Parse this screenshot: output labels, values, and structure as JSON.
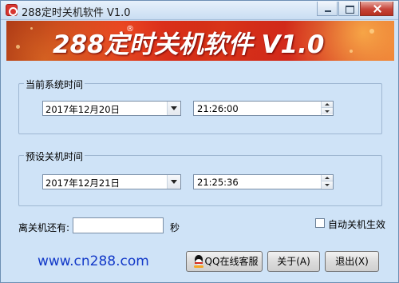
{
  "window": {
    "title": "288定时关机软件 V1.0"
  },
  "banner": {
    "text": "288定时关机软件 V1.0",
    "brand": "288",
    "registered_mark": "®"
  },
  "current_time_group": {
    "legend": "当前系统时间",
    "date_value": "2017年12月20日",
    "time_value": "21:26:00"
  },
  "shutdown_time_group": {
    "legend": "预设关机时间",
    "date_value": "2017年12月21日",
    "time_value": "21:25:36"
  },
  "countdown": {
    "label": "离关机还有:",
    "value": "",
    "unit": "秒"
  },
  "auto_shutdown": {
    "label": "自动关机生效",
    "checked": false
  },
  "footer": {
    "website": "www.cn288.com",
    "qq_button": "QQ在线客服",
    "about_button": "关于(A)",
    "exit_button": "退出(X)"
  },
  "colors": {
    "window_bg": "#cfe3f7",
    "banner_red": "#c21c12",
    "link_blue": "#1138c8"
  },
  "icons": {
    "app": "app-icon",
    "qq": "qq-penguin-icon"
  }
}
